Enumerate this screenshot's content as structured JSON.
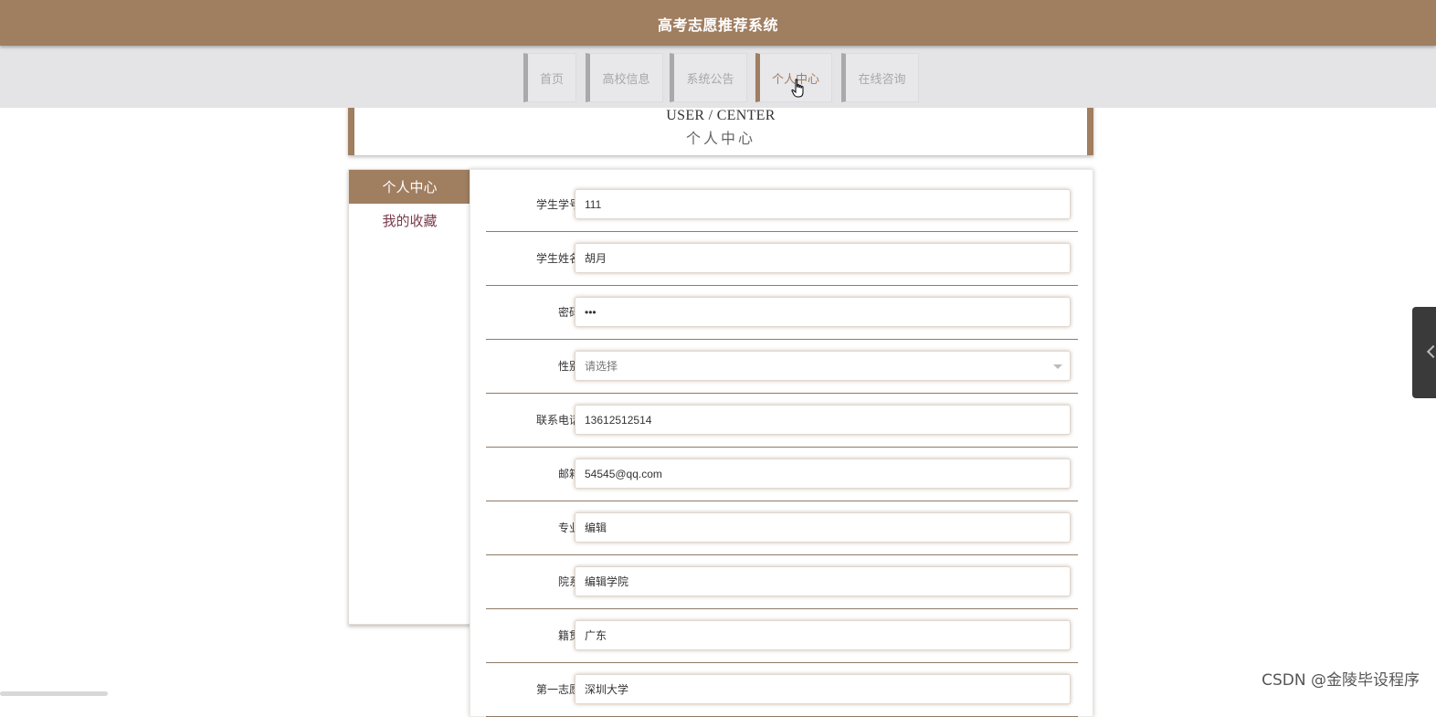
{
  "header": {
    "title": "高考志愿推荐系统"
  },
  "nav": {
    "items": [
      {
        "label": "首页"
      },
      {
        "label": "高校信息"
      },
      {
        "label": "系统公告"
      },
      {
        "label": "个人中心",
        "active": true
      },
      {
        "label": "在线咨询"
      }
    ]
  },
  "section": {
    "title_en": "USER / CENTER",
    "title_cn": "个人中心"
  },
  "sidebar": {
    "items": [
      {
        "label": "个人中心",
        "active": true
      },
      {
        "label": "我的收藏"
      }
    ]
  },
  "form": {
    "fields": [
      {
        "label": "学生学号",
        "value": "111"
      },
      {
        "label": "学生姓名",
        "value": "胡月"
      },
      {
        "label": "密码",
        "value": "•••"
      },
      {
        "label": "性别",
        "value": "请选择",
        "type": "select"
      },
      {
        "label": "联系电话",
        "value": "13612512514"
      },
      {
        "label": "邮箱",
        "value": "54545@qq.com"
      },
      {
        "label": "专业",
        "value": "编辑"
      },
      {
        "label": "院系",
        "value": "编辑学院"
      },
      {
        "label": "籍贯",
        "value": "广东"
      },
      {
        "label": "第一志愿",
        "value": "深圳大学"
      }
    ]
  },
  "watermark": "CSDN @金陵毕设程序",
  "colors": {
    "brand": "#a07e60",
    "nav_bg": "#e4e3e6",
    "side_link": "#7a3b4a"
  }
}
